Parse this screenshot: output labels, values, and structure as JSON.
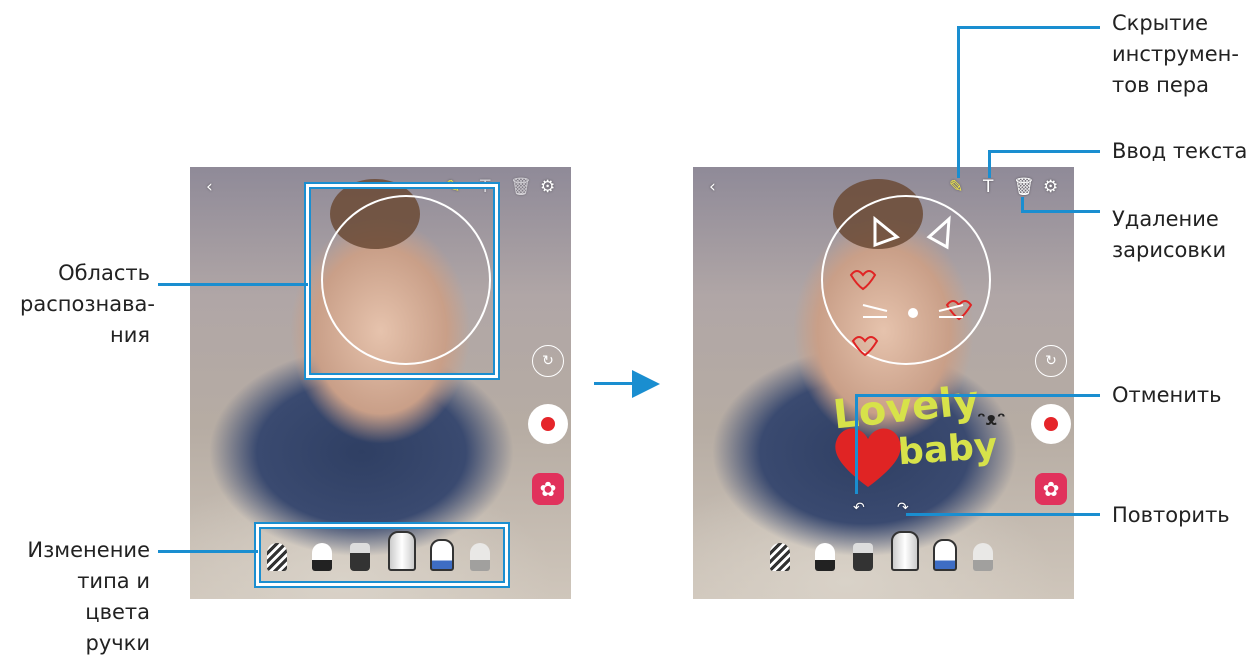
{
  "labels": {
    "recognition_area": "Область распознава-ния",
    "recognition_area_lines": [
      "Область",
      "распознава-",
      "ния"
    ],
    "change_pen": [
      "Изменение",
      "типа и цвета",
      "ручки"
    ],
    "hide_pen_tools": [
      "Скрытие",
      "инструмен-",
      "тов пера"
    ],
    "text_input": "Ввод текста",
    "delete_sketch": [
      "Удаление",
      "зарисовки"
    ],
    "undo": "Отменить",
    "redo": "Повторить"
  },
  "doodle": {
    "word1": "Lovely",
    "word2": "baby"
  },
  "icons": {
    "back": "chevron-left-icon",
    "pen": "pen-icon",
    "text": "text-icon",
    "trash": "trash-icon",
    "settings": "gear-icon",
    "switch_camera": "switch-camera-icon",
    "record": "record-icon",
    "effect": "flower-icon",
    "undo": "undo-icon",
    "redo": "redo-icon"
  },
  "colors": {
    "callout": "#1a8ed0",
    "record_dot": "#e5252a",
    "effect_button": "#e1325c",
    "doodle_yellow": "#d7e24a",
    "doodle_red": "#e02424"
  }
}
